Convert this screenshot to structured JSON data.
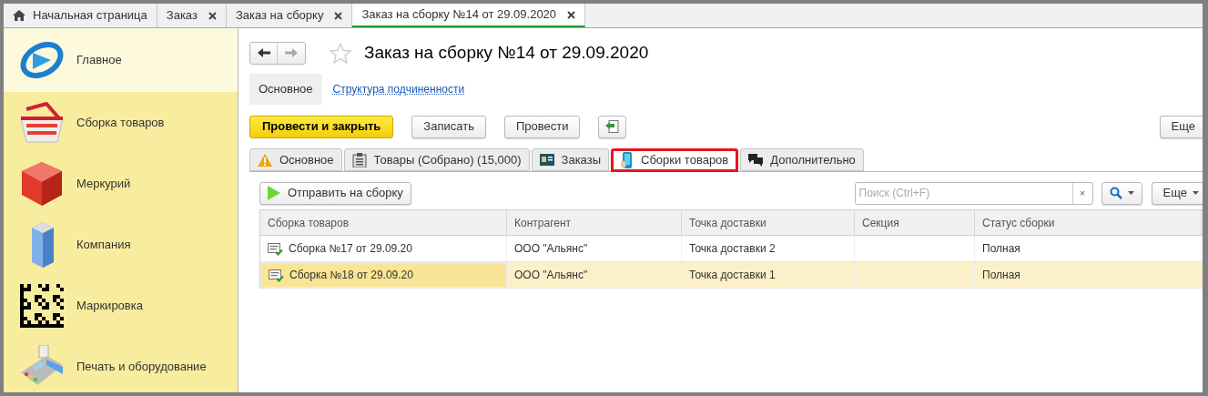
{
  "window_tabs": [
    {
      "kind": "home",
      "label": "Начальная страница",
      "selected": false
    },
    {
      "kind": "doc",
      "label": "Заказ",
      "selected": false
    },
    {
      "kind": "doc",
      "label": "Заказ на сборку",
      "selected": false
    },
    {
      "kind": "doc",
      "label": "Заказ на сборку №14 от 29.09.2020",
      "selected": true
    }
  ],
  "sidebar": {
    "items": [
      {
        "kind": "logo",
        "label": "Главное",
        "selected": true
      },
      {
        "kind": "basket",
        "label": "Сборка товаров",
        "selected": false
      },
      {
        "kind": "cube",
        "label": "Меркурий",
        "selected": false
      },
      {
        "kind": "building",
        "label": "Компания",
        "selected": false
      },
      {
        "kind": "code",
        "label": "Маркировка",
        "selected": false
      },
      {
        "kind": "terminal",
        "label": "Печать и оборудование",
        "selected": false
      }
    ]
  },
  "document": {
    "title": "Заказ на сборку №14 от 29.09.2020",
    "favorite": false,
    "sections": [
      {
        "kind": "plain",
        "label": "Основное"
      },
      {
        "kind": "link",
        "label": "Структура подчиненности"
      }
    ],
    "commands": [
      {
        "kind": "primary",
        "label": "Провести и закрыть"
      },
      {
        "kind": "normal",
        "label": "Записать"
      },
      {
        "kind": "normal",
        "label": "Провести"
      },
      {
        "kind": "icon"
      }
    ],
    "more": "Еще",
    "tabs": [
      {
        "kind": "warning",
        "label": "Основное",
        "selected": false,
        "marked": false
      },
      {
        "kind": "clipboard",
        "label": "Товары (Собрано) (15,000)",
        "selected": false,
        "marked": false
      },
      {
        "kind": "card",
        "label": "Заказы",
        "selected": false,
        "marked": false
      },
      {
        "kind": "phone",
        "label": "Сборки товаров",
        "selected": true,
        "marked": true
      },
      {
        "kind": "chat",
        "label": "Дополнительно",
        "selected": false,
        "marked": false
      }
    ],
    "panel": {
      "send_button": "Отправить на сборку",
      "search": {
        "placeholder": "Поиск (Ctrl+F)",
        "clear": "×"
      },
      "more": "Еще",
      "table": {
        "columns": [
          "Сборка товаров",
          "Контрагент",
          "Точка доставки",
          "Секция",
          "Статус сборки"
        ],
        "rows": [
          {
            "selected": false,
            "cells": [
              "Сборка №17 от 29.09.20",
              "ООО \"Альянс\"",
              "Точка  доставки 2",
              "",
              "Полная"
            ]
          },
          {
            "selected": true,
            "cells": [
              "Сборка №18 от 29.09.20",
              "ООО \"Альянс\"",
              "Точка  доставки 1",
              "",
              "Полная"
            ]
          }
        ]
      }
    }
  }
}
